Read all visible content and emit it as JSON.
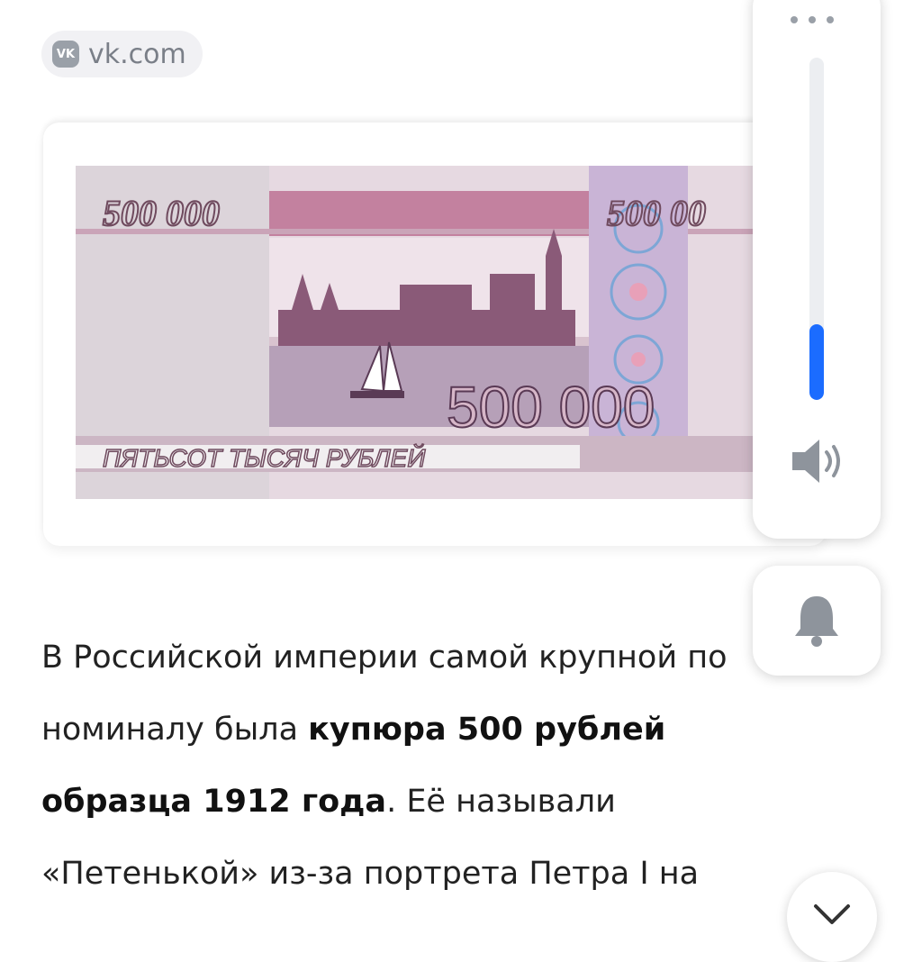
{
  "source": {
    "label": "vk.com",
    "icon": "vk-icon"
  },
  "image": {
    "denomination_top_left": "500 000",
    "denomination_top_right": "500 00",
    "denomination_main": "500 000",
    "denomination_words": "ПЯТЬСОТ ТЫСЯЧ РУБЛЕЙ"
  },
  "article": {
    "line1": "В Российской империи самой крупной по",
    "line2_plain": "номиналу была ",
    "line2_bold": "купюра 500 рублей",
    "line3_bold": "образца 1912 года",
    "line3_plain": ". Её называли",
    "line4": "«Петенькой» из-за портрета Петра I на"
  },
  "volume": {
    "level": 0.22,
    "icons": [
      "more-dots-icon",
      "speaker-icon"
    ]
  },
  "notifications": {
    "icon": "bell-icon"
  },
  "collapse": {
    "icon": "chevron-down-icon"
  },
  "colors": {
    "accent": "#1b6cff",
    "note_main": "#b88ea6",
    "note_dark": "#7a4a68"
  }
}
